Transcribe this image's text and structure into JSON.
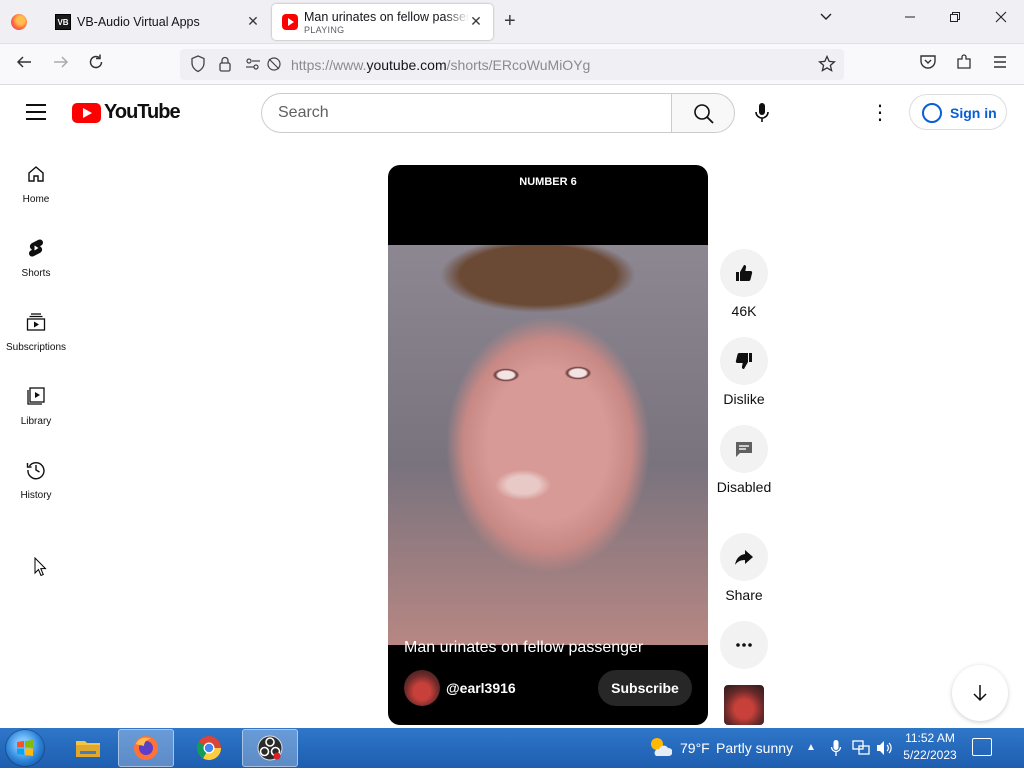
{
  "browser": {
    "tabs": [
      {
        "title": "VB-Audio Virtual Apps",
        "favicon": "vb-audio-icon"
      },
      {
        "title": "Man urinates on fellow passenger",
        "subtitle": "PLAYING",
        "favicon": "youtube-icon"
      }
    ],
    "url_prefix": "https://www.",
    "url_domain": "youtube.com",
    "url_path": "/shorts/ERcoWuMiOYg"
  },
  "youtube": {
    "logo_text": "YouTube",
    "search_placeholder": "Search",
    "sign_in": "Sign in"
  },
  "sidebar": {
    "items": [
      {
        "label": "Home",
        "icon": "home-icon"
      },
      {
        "label": "Shorts",
        "icon": "shorts-icon"
      },
      {
        "label": "Subscriptions",
        "icon": "subscriptions-icon"
      },
      {
        "label": "Library",
        "icon": "library-icon"
      },
      {
        "label": "History",
        "icon": "history-icon"
      }
    ]
  },
  "short": {
    "overlay_caption": "NUMBER 6",
    "title": "Man urinates on fellow passenger",
    "channel": "@earl3916",
    "subscribe": "Subscribe"
  },
  "actions": {
    "like_count": "46K",
    "dislike": "Dislike",
    "comments": "Disabled",
    "share": "Share"
  },
  "taskbar": {
    "weather_temp": "79°F",
    "weather_desc": "Partly sunny",
    "time": "11:52 AM",
    "date": "5/22/2023"
  }
}
